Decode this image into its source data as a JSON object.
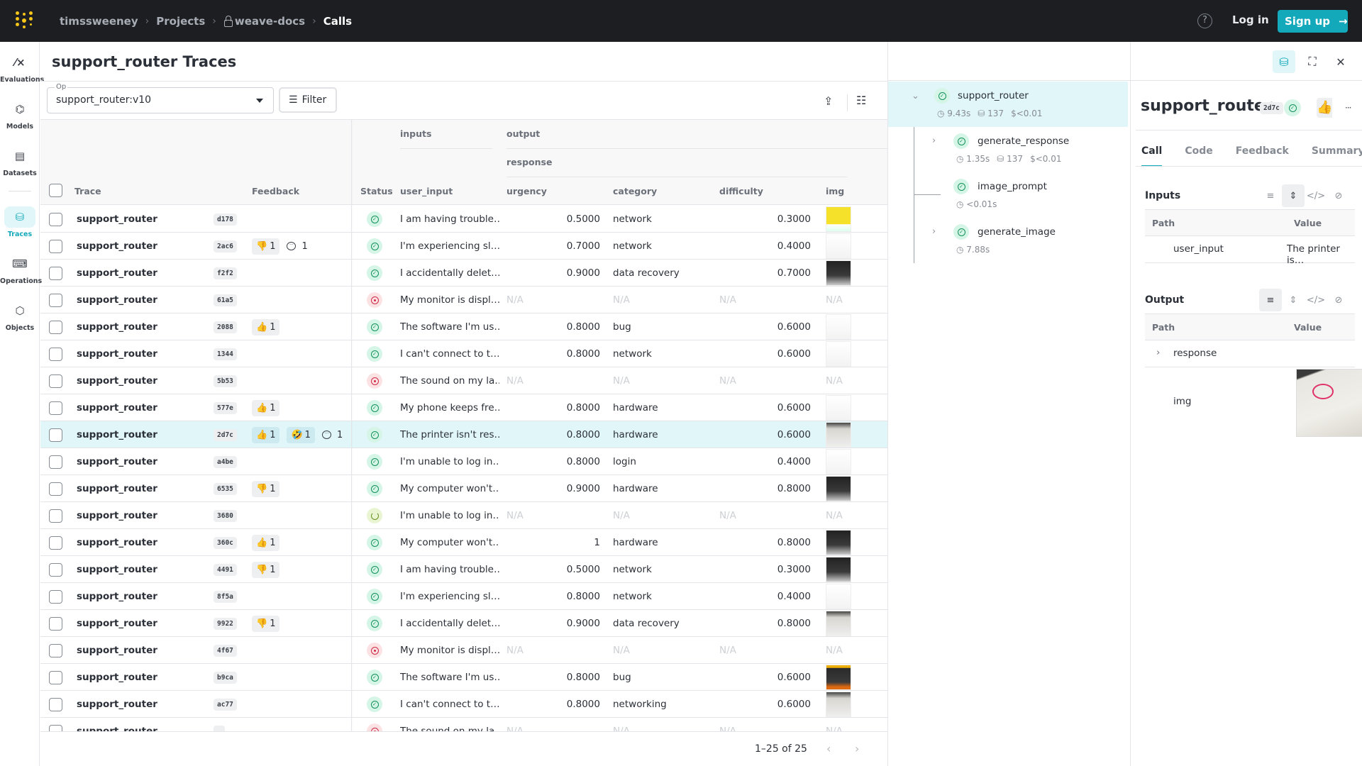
{
  "topbar": {
    "breadcrumb": [
      "timssweeney",
      "Projects",
      "weave-docs",
      "Calls"
    ],
    "help_icon": "question-circle-icon",
    "login_label": "Log in",
    "signup_label": "Sign up",
    "signup_icon": "→",
    "brand_color": "#13a9ba"
  },
  "sidebar": {
    "items": [
      {
        "label": "Evaluations",
        "icon": "⁄×"
      },
      {
        "label": "Models",
        "icon": "⌬"
      },
      {
        "label": "Datasets",
        "icon": "▤"
      },
      {
        "label": "Traces",
        "icon": "⛁",
        "active": true
      },
      {
        "label": "Operations",
        "icon": "⌨"
      },
      {
        "label": "Objects",
        "icon": "⬡"
      }
    ]
  },
  "main": {
    "title": "support_router Traces",
    "op_label": "Op",
    "op_value": "support_router:v10",
    "filter_label": "Filter",
    "filter_icon": "☰",
    "export_icon": "⇪",
    "columns_icon": "☷",
    "headers": {
      "trace": "Trace",
      "feedback": "Feedback",
      "status": "Status",
      "inputs": "inputs",
      "user_input": "user_input",
      "output": "output",
      "response": "response",
      "urgency": "urgency",
      "category": "category",
      "difficulty": "difficulty",
      "img": "img"
    },
    "rows": [
      {
        "name": "support_router",
        "hash": "d178",
        "feedback": [],
        "comments": null,
        "status": "success",
        "user_input": "I am having trouble…",
        "urgency": "0.5000",
        "category": "network",
        "difficulty": "0.3000",
        "img": "yellow"
      },
      {
        "name": "support_router",
        "hash": "2ac6",
        "feedback": [
          {
            "emoji": "👎",
            "count": "1"
          }
        ],
        "comments": "1",
        "status": "success",
        "user_input": "I'm experiencing sl…",
        "urgency": "0.7000",
        "category": "network",
        "difficulty": "0.4000",
        "img": "white"
      },
      {
        "name": "support_router",
        "hash": "f2f2",
        "feedback": [],
        "comments": null,
        "status": "success",
        "user_input": "I accidentally delet…",
        "urgency": "0.9000",
        "category": "data recovery",
        "difficulty": "0.7000",
        "img": "dark"
      },
      {
        "name": "support_router",
        "hash": "61a5",
        "feedback": [],
        "comments": null,
        "status": "error",
        "user_input": "My monitor is displ…",
        "urgency": "N/A",
        "category": "N/A",
        "difficulty": "N/A",
        "img": "N/A"
      },
      {
        "name": "support_router",
        "hash": "2088",
        "feedback": [
          {
            "emoji": "👍",
            "count": "1"
          }
        ],
        "comments": null,
        "status": "success",
        "user_input": "The software I'm us…",
        "urgency": "0.8000",
        "category": "bug",
        "difficulty": "0.6000",
        "img": "white"
      },
      {
        "name": "support_router",
        "hash": "1344",
        "feedback": [],
        "comments": null,
        "status": "success",
        "user_input": "I can't connect to t…",
        "urgency": "0.8000",
        "category": "network",
        "difficulty": "0.6000",
        "img": "white"
      },
      {
        "name": "support_router",
        "hash": "5b53",
        "feedback": [],
        "comments": null,
        "status": "error",
        "user_input": "The sound on my la…",
        "urgency": "N/A",
        "category": "N/A",
        "difficulty": "N/A",
        "img": "N/A"
      },
      {
        "name": "support_router",
        "hash": "577e",
        "feedback": [
          {
            "emoji": "👍",
            "count": "1"
          }
        ],
        "comments": null,
        "status": "success",
        "user_input": "My phone keeps fre…",
        "urgency": "0.8000",
        "category": "hardware",
        "difficulty": "0.6000",
        "img": "white"
      },
      {
        "name": "support_router",
        "hash": "2d7c",
        "feedback": [
          {
            "emoji": "👍",
            "count": "1"
          },
          {
            "emoji": "🤣",
            "count": "1"
          }
        ],
        "comments": "1",
        "status": "success",
        "user_input": "The printer isn't res…",
        "urgency": "0.8000",
        "category": "hardware",
        "difficulty": "0.6000",
        "img": "gray",
        "selected": true
      },
      {
        "name": "support_router",
        "hash": "a4be",
        "feedback": [],
        "comments": null,
        "status": "success",
        "user_input": "I'm unable to log in…",
        "urgency": "0.8000",
        "category": "login",
        "difficulty": "0.4000",
        "img": "white"
      },
      {
        "name": "support_router",
        "hash": "6535",
        "feedback": [
          {
            "emoji": "👎",
            "count": "1"
          }
        ],
        "comments": null,
        "status": "success",
        "user_input": "My computer won't…",
        "urgency": "0.9000",
        "category": "hardware",
        "difficulty": "0.8000",
        "img": "dark"
      },
      {
        "name": "support_router",
        "hash": "3680",
        "feedback": [],
        "comments": null,
        "status": "running",
        "user_input": "I'm unable to log in…",
        "urgency": "N/A",
        "category": "N/A",
        "difficulty": "N/A",
        "img": "N/A"
      },
      {
        "name": "support_router",
        "hash": "360c",
        "feedback": [
          {
            "emoji": "👍",
            "count": "1"
          }
        ],
        "comments": null,
        "status": "success",
        "user_input": "My computer won't…",
        "urgency": "1",
        "category": "hardware",
        "difficulty": "0.8000",
        "img": "dark"
      },
      {
        "name": "support_router",
        "hash": "4491",
        "feedback": [
          {
            "emoji": "👎",
            "count": "1"
          }
        ],
        "comments": null,
        "status": "success",
        "user_input": "I am having trouble…",
        "urgency": "0.5000",
        "category": "network",
        "difficulty": "0.3000",
        "img": "dark"
      },
      {
        "name": "support_router",
        "hash": "8f5a",
        "feedback": [],
        "comments": null,
        "status": "success",
        "user_input": "I'm experiencing sl…",
        "urgency": "0.8000",
        "category": "network",
        "difficulty": "0.4000",
        "img": "white"
      },
      {
        "name": "support_router",
        "hash": "9922",
        "feedback": [
          {
            "emoji": "👎",
            "count": "1"
          }
        ],
        "comments": null,
        "status": "success",
        "user_input": "I accidentally delet…",
        "urgency": "0.9000",
        "category": "data recovery",
        "difficulty": "0.8000",
        "img": "gray"
      },
      {
        "name": "support_router",
        "hash": "4f67",
        "feedback": [],
        "comments": null,
        "status": "error",
        "user_input": "My monitor is displ…",
        "urgency": "N/A",
        "category": "N/A",
        "difficulty": "N/A",
        "img": "N/A"
      },
      {
        "name": "support_router",
        "hash": "b9ca",
        "feedback": [],
        "comments": null,
        "status": "success",
        "user_input": "The software I'm us…",
        "urgency": "0.8000",
        "category": "bug",
        "difficulty": "0.6000",
        "img": "orange"
      },
      {
        "name": "support_router",
        "hash": "ac77",
        "feedback": [],
        "comments": null,
        "status": "success",
        "user_input": "I can't connect to t…",
        "urgency": "0.8000",
        "category": "networking",
        "difficulty": "0.6000",
        "img": "gray"
      },
      {
        "name": "support_router",
        "hash": "…",
        "feedback": [],
        "comments": null,
        "status": "error",
        "user_input": "The sound on my la…",
        "urgency": "N/A",
        "category": "N/A",
        "difficulty": "N/A",
        "img": "N/A"
      }
    ],
    "pagination": {
      "text": "1–25 of 25",
      "prev": "‹",
      "next": "›"
    }
  },
  "trace_tree": {
    "nodes": [
      {
        "name": "support_router",
        "latency": "9.43s",
        "tokens": "137",
        "cost": "$<0.01",
        "expanded": true,
        "selected": true
      },
      {
        "name": "generate_response",
        "latency": "1.35s",
        "tokens": "137",
        "cost": "$<0.01",
        "expandable": true
      },
      {
        "name": "image_prompt",
        "latency": "<0.01s"
      },
      {
        "name": "generate_image",
        "latency": "7.88s",
        "expandable": true
      }
    ]
  },
  "detail": {
    "title": "support_router",
    "hash": "2d7c",
    "feedback_emoji": "👍",
    "more_icon": "···",
    "tabs": [
      "Call",
      "Code",
      "Feedback",
      "Summary"
    ],
    "active_tab": "Call",
    "inputs": {
      "title": "Inputs",
      "path_header": "Path",
      "value_header": "Value",
      "rows": [
        {
          "path": "user_input",
          "value": "The printer is…"
        }
      ]
    },
    "output": {
      "title": "Output",
      "path_header": "Path",
      "value_header": "Value",
      "rows": [
        {
          "path": "response",
          "expandable": true
        },
        {
          "path": "img",
          "image": true
        }
      ]
    }
  }
}
